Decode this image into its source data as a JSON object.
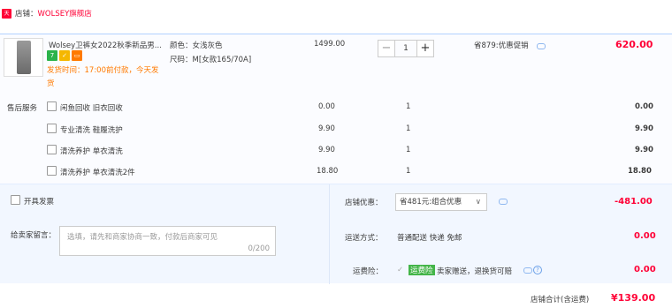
{
  "shop": {
    "badge": "天猫",
    "label": "店铺：",
    "name": "WOLSEY旗舰店"
  },
  "item": {
    "title": "Wolsey卫裤女2022秋季新品男...",
    "color_label": "颜色：女浅灰色",
    "size_label": "尺码：M[女款165/70A]",
    "shipping_line1": "发货时间：17:00前付款，今天发",
    "shipping_line2": "货",
    "unit_price": "1499.00",
    "quantity": "1",
    "minus": "−",
    "plus": "+",
    "discount_note": "省879:优惠促销",
    "line_total": "620.00"
  },
  "services": {
    "title": "售后服务",
    "rows": [
      {
        "label": "闲鱼回收 旧衣回收",
        "price": "0.00",
        "qty": "1",
        "total": "0.00"
      },
      {
        "label": "专业清洗 鞋履洗护",
        "price": "9.90",
        "qty": "1",
        "total": "9.90"
      },
      {
        "label": "清洗养护 单衣清洗",
        "price": "9.90",
        "qty": "1",
        "total": "9.90"
      },
      {
        "label": "清洗养护 单衣清洗2件",
        "price": "18.80",
        "qty": "1",
        "total": "18.80"
      }
    ]
  },
  "invoice": {
    "label": "开具发票"
  },
  "message": {
    "label": "给卖家留言：",
    "placeholder": "选填，请先和商家协商一致，付款后商家可见",
    "counter": "0/200"
  },
  "store_discount": {
    "label": "店铺优惠：",
    "selected": "省481元:组合优惠",
    "value": "-481.00"
  },
  "delivery": {
    "label": "运送方式：",
    "method": "普通配送 快递 免邮",
    "value": "0.00"
  },
  "insurance": {
    "label": "运费险：",
    "tag": "运费险",
    "text": "卖家赠送，退换货可赔",
    "value": "0.00"
  },
  "footer": {
    "label": "店铺合计(含运费)",
    "total": "¥139.00"
  },
  "colors": {
    "accent_red": "#ff0036",
    "panel_blue": "#f2f7ff",
    "border_blue": "#b2d1ff"
  }
}
